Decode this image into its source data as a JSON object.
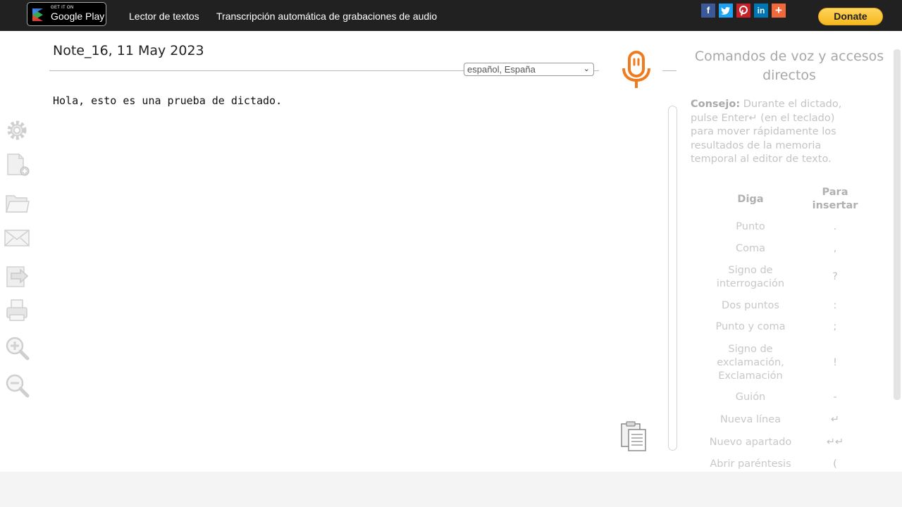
{
  "header": {
    "play_badge_small": "GET IT ON",
    "play_badge_big": "Google Play",
    "nav": [
      "Lector de textos",
      "Transcripción automática de grabaciones de audio"
    ],
    "social": [
      {
        "name": "facebook",
        "glyph": "f",
        "color": "#3b5998"
      },
      {
        "name": "twitter",
        "glyph": "t",
        "color": "#1da1f2"
      },
      {
        "name": "pinterest",
        "glyph": "P",
        "color": "#cb2027"
      },
      {
        "name": "linkedin",
        "glyph": "in",
        "color": "#0077b5"
      },
      {
        "name": "more",
        "glyph": "+",
        "color": "#f0683b"
      }
    ],
    "donate_label": "Donate"
  },
  "editor": {
    "note_title": "Note_16, 11 May 2023",
    "language": "español, España",
    "text": "Hola, esto es una prueba de dictado.",
    "accent_color": "#f07b1f"
  },
  "sidebar_icons": [
    "gear-icon",
    "new-document-icon",
    "open-folder-icon",
    "email-icon",
    "export-icon",
    "print-icon",
    "zoom-in-icon",
    "zoom-out-icon"
  ],
  "commands": {
    "title": "Comandos de voz y accesos directos",
    "tip_label": "Consejo:",
    "tip_text": "Durante el dictado, pulse Enter↵ (en el teclado) para mover rápidamente los resultados de la memoria temporal al editor de texto.",
    "col_say": "Diga",
    "col_insert": "Para insertar",
    "rows": [
      {
        "say": "Punto",
        "insert": "."
      },
      {
        "say": "Coma",
        "insert": ","
      },
      {
        "say": "Signo de interrogación",
        "insert": "?"
      },
      {
        "say": "Dos puntos",
        "insert": ":"
      },
      {
        "say": "Punto y coma",
        "insert": ";"
      },
      {
        "say": "Signo de exclamación, Exclamación",
        "insert": "!"
      },
      {
        "say": "Guión",
        "insert": "-"
      },
      {
        "say": "Nueva línea",
        "insert": "↵"
      },
      {
        "say": "Nuevo apartado",
        "insert": "↵↵"
      },
      {
        "say": "Abrir paréntesis",
        "insert": "("
      }
    ]
  }
}
